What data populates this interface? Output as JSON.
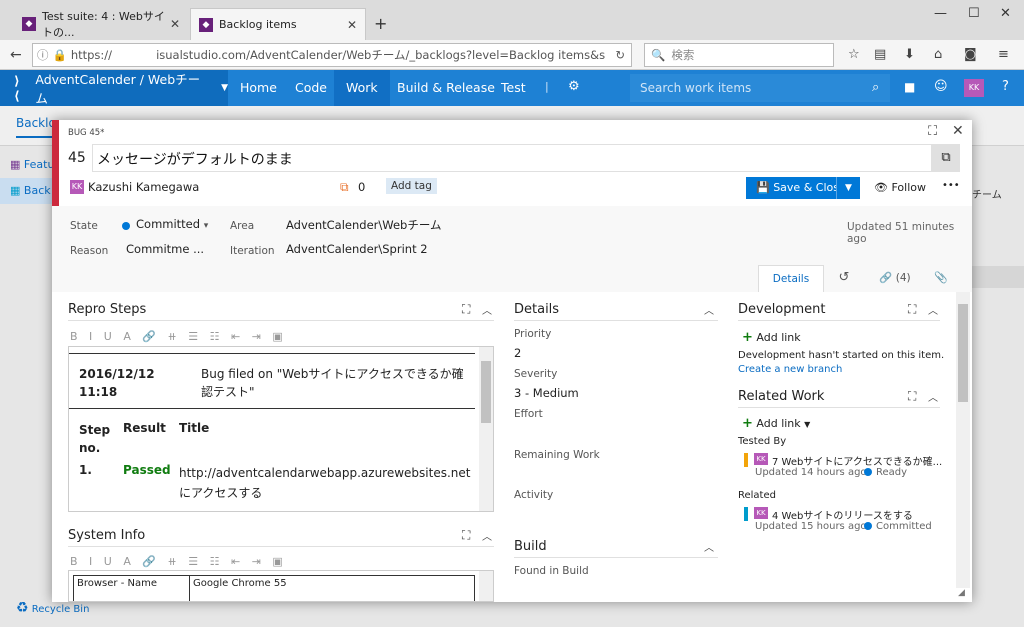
{
  "browser": {
    "tabs": [
      {
        "title": "Test suite: 4 : Webサイトの..."
      },
      {
        "title": "Backlog items"
      }
    ],
    "url_prefix": "https://",
    "url": "isualstudio.com/AdventCalender/Webチーム/_backlogs?level=Backlog items&showPar",
    "search_placeholder": "検索",
    "new_tab": "+",
    "close": "✕"
  },
  "vsts": {
    "project": "AdventCalender / Webチーム",
    "nav": [
      "Home",
      "Code",
      "Work",
      "Build & Release",
      "Test"
    ],
    "search_placeholder": "Search work items",
    "avatar": "KK"
  },
  "background": {
    "backlog_tab": "Backlo",
    "items": [
      "Featu",
      "Back"
    ],
    "recycle": "Recycle Bin",
    "right_snippet": "チーム"
  },
  "workitem": {
    "type": "BUG 45*",
    "id": "45",
    "title": "メッセージがデフォルトのまま",
    "assignee": "Kazushi Kamegawa",
    "avatar": "KK",
    "comments": "0",
    "add_tag": "Add tag",
    "save": "Save & Close",
    "follow": "Follow",
    "more": "•••",
    "state_label": "State",
    "state": "Committed",
    "reason_label": "Reason",
    "reason": "Commitme ...",
    "area_label": "Area",
    "area": "AdventCalender\\Webチーム",
    "iteration_label": "Iteration",
    "iteration": "AdventCalender\\Sprint 2",
    "updated": "Updated 51 minutes ago",
    "tabs": {
      "details": "Details",
      "history": "↺",
      "links": "(4)",
      "attachments": "📎"
    },
    "repro": {
      "title": "Repro Steps",
      "date": "2016/12/12 11:18",
      "filed": "Bug filed on \"Webサイトにアクセスできるか確認テスト\"",
      "col_step": "Step no.",
      "col_result": "Result",
      "col_title": "Title",
      "step1": "1.",
      "result1": "Passed",
      "title1": "http://adventcalendarwebapp.azurewebsites.net にアクセスする"
    },
    "sysinfo": {
      "title": "System Info",
      "browser_name": "Browser - Name",
      "browser_val": "Google Chrome 55"
    },
    "details": {
      "title": "Details",
      "priority_label": "Priority",
      "priority": "2",
      "severity_label": "Severity",
      "severity": "3 - Medium",
      "effort_label": "Effort",
      "remaining_label": "Remaining Work",
      "activity_label": "Activity"
    },
    "build": {
      "title": "Build",
      "found_label": "Found in Build"
    },
    "development": {
      "title": "Development",
      "add_link": "Add link",
      "note": "Development hasn't started on this item.",
      "create_branch": "Create a new branch"
    },
    "related": {
      "title": "Related Work",
      "add_link": "Add link",
      "tested_by": "Tested By",
      "item1": "7 Webサイトにアクセスできるか確...",
      "item1_meta": "Updated 14 hours ago,",
      "item1_state": "Ready",
      "related_label": "Related",
      "item2": "4 Webサイトのリリースをする",
      "item2_meta": "Updated 15 hours ago,",
      "item2_state": "Committed",
      "avatar": "KK"
    }
  },
  "colors": {
    "accent": "#0078d7",
    "bug_red": "#cc293d",
    "header": "#1e81d4",
    "passed": "#107c10",
    "ready": "#0078d7",
    "committed": "#0078d7",
    "testcase": "#f2a40a",
    "pbi": "#009ccc",
    "avatar": "#b659b8"
  }
}
